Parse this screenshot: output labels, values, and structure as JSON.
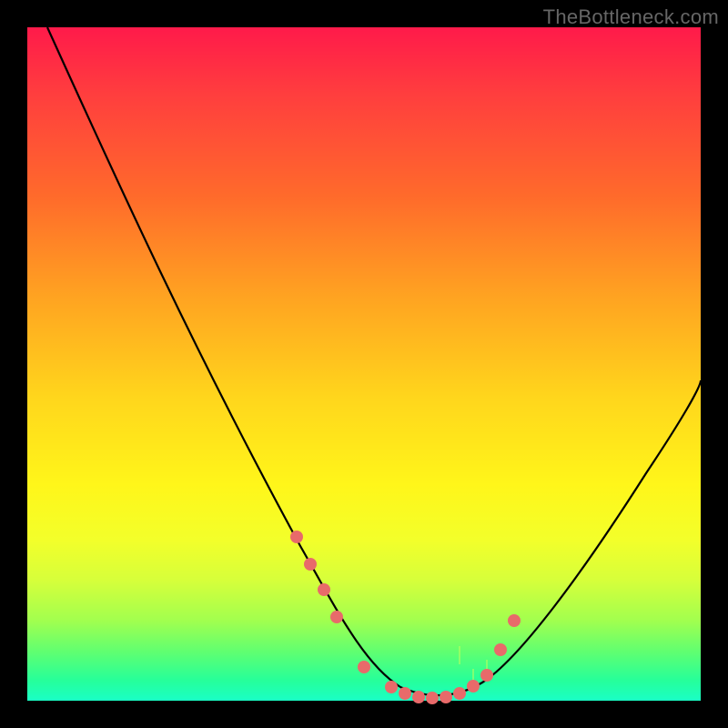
{
  "watermark": "TheBottleneck.com",
  "chart_data": {
    "type": "line",
    "title": "",
    "xlabel": "",
    "ylabel": "",
    "xlim": [
      0,
      100
    ],
    "ylim": [
      0,
      100
    ],
    "series": [
      {
        "name": "bottleneck-curve",
        "x": [
          3,
          10,
          20,
          30,
          40,
          43,
          47,
          50,
          54,
          58,
          62,
          66,
          70,
          80,
          90,
          100
        ],
        "values": [
          100,
          84,
          66,
          48,
          28,
          22,
          13,
          6,
          2,
          0,
          0,
          2,
          6,
          20,
          36,
          52
        ]
      }
    ],
    "highlight_points": {
      "name": "marker-dots",
      "x": [
        40,
        42,
        44,
        46,
        50,
        54,
        56,
        58,
        60,
        62,
        64,
        66,
        68,
        70,
        72
      ],
      "values": [
        24,
        20,
        16,
        12,
        4,
        1,
        0,
        0,
        0,
        0,
        1,
        2,
        4,
        8,
        12
      ]
    },
    "colors": {
      "gradient_top": "#ff1a4a",
      "gradient_bottom": "#1affc6",
      "curve": "#000000",
      "dots": "#e86a6a",
      "background": "#000000"
    }
  }
}
